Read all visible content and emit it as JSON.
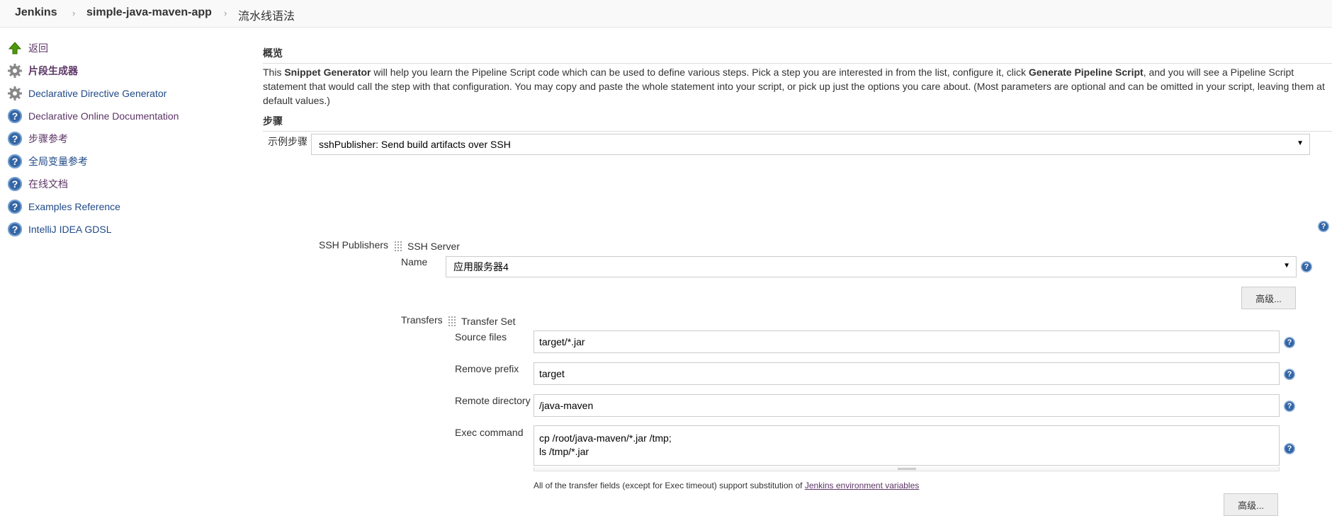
{
  "breadcrumb": {
    "items": [
      "Jenkins",
      "simple-java-maven-app",
      "流水线语法"
    ],
    "separator": "›"
  },
  "sidebar": {
    "items": [
      {
        "label": "返回",
        "icon": "up-arrow-icon"
      },
      {
        "label": "片段生成器",
        "icon": "gear-icon"
      },
      {
        "label": "Declarative Directive Generator",
        "icon": "gear-icon"
      },
      {
        "label": "Declarative Online Documentation",
        "icon": "help-icon"
      },
      {
        "label": "步骤参考",
        "icon": "help-icon"
      },
      {
        "label": "全局变量参考",
        "icon": "help-icon"
      },
      {
        "label": "在线文档",
        "icon": "help-icon"
      },
      {
        "label": "Examples Reference",
        "icon": "help-icon"
      },
      {
        "label": "IntelliJ IDEA GDSL",
        "icon": "help-icon"
      }
    ]
  },
  "overview": {
    "heading": "概览",
    "intro_before": "This ",
    "intro_bold1": "Snippet Generator",
    "intro_mid": " will help you learn the Pipeline Script code which can be used to define various steps. Pick a step you are interested in from the list, configure it, click ",
    "intro_bold2": "Generate Pipeline Script",
    "intro_after": ", and you will see a Pipeline Script statement that would call the step with that configuration. You may copy and paste the whole statement into your script, or pick up just the options you care about. (Most parameters are optional and can be omitted in your script, leaving them at default values.)"
  },
  "steps": {
    "heading": "步骤",
    "sample_step_label": "示例步骤",
    "sample_step_value": "sshPublisher: Send build artifacts over SSH"
  },
  "ssh": {
    "publishers_label": "SSH Publishers",
    "server_label": "SSH Server",
    "name_label": "Name",
    "name_value": "应用服务器4",
    "advanced_label": "高级...",
    "transfers_label": "Transfers",
    "transfer_set_label": "Transfer Set",
    "source_files_label": "Source files",
    "source_files_value": "target/*.jar",
    "remove_prefix_label": "Remove prefix",
    "remove_prefix_value": "target",
    "remote_directory_label": "Remote directory",
    "remote_directory_value": "/java-maven",
    "exec_command_label": "Exec command",
    "exec_command_value": "cp /root/java-maven/*.jar /tmp;\nls /tmp/*.jar",
    "footnote_text": "All of the transfer fields (except for Exec timeout) support substitution of ",
    "footnote_link": "Jenkins environment variables",
    "advanced2_label": "高级..."
  },
  "help_mark": "?",
  "dropdown_arrow": "▼"
}
